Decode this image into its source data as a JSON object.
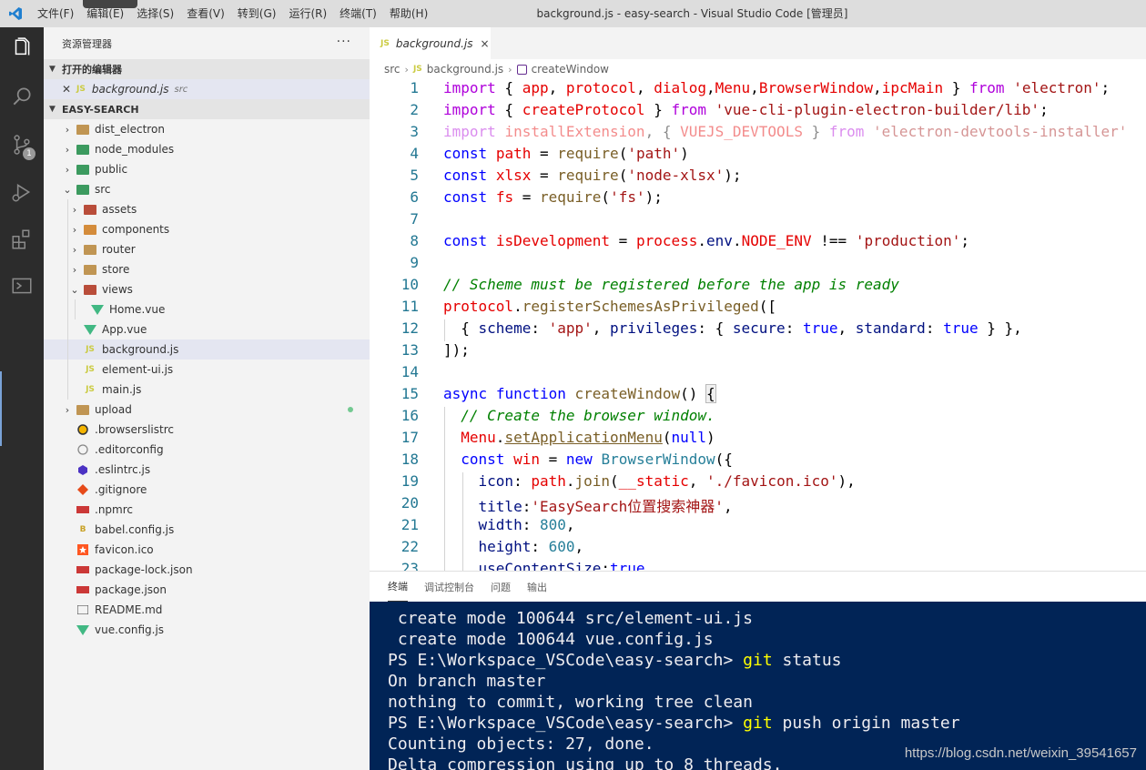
{
  "titlebar": {
    "menu": [
      "文件(F)",
      "编辑(E)",
      "选择(S)",
      "查看(V)",
      "转到(G)",
      "运行(R)",
      "终端(T)",
      "帮助(H)"
    ],
    "title": "background.js - easy-search - Visual Studio Code [管理员]"
  },
  "activity": {
    "scm_badge": "1"
  },
  "sidebar": {
    "header": "资源管理器",
    "more": "···",
    "open_editors_label": "打开的编辑器",
    "open_editor": {
      "name": "background.js",
      "desc": "src"
    },
    "workspace_label": "EASY-SEARCH",
    "tree": [
      {
        "name": "dist_electron",
        "type": "folder",
        "depth": 0,
        "twisty": "›",
        "icon": "folder"
      },
      {
        "name": "node_modules",
        "type": "folder",
        "depth": 0,
        "twisty": "›",
        "icon": "folder-green"
      },
      {
        "name": "public",
        "type": "folder",
        "depth": 0,
        "twisty": "›",
        "icon": "folder-green"
      },
      {
        "name": "src",
        "type": "folder",
        "depth": 0,
        "twisty": "⌄",
        "icon": "folder-green"
      },
      {
        "name": "assets",
        "type": "folder",
        "depth": 1,
        "twisty": "›",
        "icon": "folder-red"
      },
      {
        "name": "components",
        "type": "folder",
        "depth": 1,
        "twisty": "›",
        "icon": "folder-orange"
      },
      {
        "name": "router",
        "type": "folder",
        "depth": 1,
        "twisty": "›",
        "icon": "folder"
      },
      {
        "name": "store",
        "type": "folder",
        "depth": 1,
        "twisty": "›",
        "icon": "folder"
      },
      {
        "name": "views",
        "type": "folder",
        "depth": 1,
        "twisty": "⌄",
        "icon": "folder-red"
      },
      {
        "name": "Home.vue",
        "type": "file",
        "depth": 2,
        "icon": "vue"
      },
      {
        "name": "App.vue",
        "type": "file",
        "depth": 1,
        "icon": "vue"
      },
      {
        "name": "background.js",
        "type": "file",
        "depth": 1,
        "icon": "js",
        "selected": true
      },
      {
        "name": "element-ui.js",
        "type": "file",
        "depth": 1,
        "icon": "js"
      },
      {
        "name": "main.js",
        "type": "file",
        "depth": 1,
        "icon": "js"
      },
      {
        "name": "upload",
        "type": "folder",
        "depth": 0,
        "twisty": "›",
        "icon": "folder",
        "modified": true
      },
      {
        "name": ".browserslistrc",
        "type": "file",
        "depth": 0,
        "icon": "browserslist"
      },
      {
        "name": ".editorconfig",
        "type": "file",
        "depth": 0,
        "icon": "editorconfig"
      },
      {
        "name": ".eslintrc.js",
        "type": "file",
        "depth": 0,
        "icon": "eslint"
      },
      {
        "name": ".gitignore",
        "type": "file",
        "depth": 0,
        "icon": "git"
      },
      {
        "name": ".npmrc",
        "type": "file",
        "depth": 0,
        "icon": "npm"
      },
      {
        "name": "babel.config.js",
        "type": "file",
        "depth": 0,
        "icon": "babel"
      },
      {
        "name": "favicon.ico",
        "type": "file",
        "depth": 0,
        "icon": "favicon"
      },
      {
        "name": "package-lock.json",
        "type": "file",
        "depth": 0,
        "icon": "npm"
      },
      {
        "name": "package.json",
        "type": "file",
        "depth": 0,
        "icon": "npm"
      },
      {
        "name": "README.md",
        "type": "file",
        "depth": 0,
        "icon": "readme"
      },
      {
        "name": "vue.config.js",
        "type": "file",
        "depth": 0,
        "icon": "vue"
      }
    ]
  },
  "tab": {
    "badge": "JS",
    "name": "background.js",
    "close": "×"
  },
  "breadcrumb": {
    "folder": "src",
    "file": "background.js",
    "symbol": "createWindow"
  },
  "editor": {
    "line_numbers": [
      "1",
      "2",
      "3",
      "4",
      "5",
      "6",
      "7",
      "8",
      "9",
      "10",
      "11",
      "12",
      "13",
      "14",
      "15",
      "16",
      "17",
      "18",
      "19",
      "20",
      "21",
      "22",
      "23"
    ]
  },
  "panel": {
    "tabs": [
      "终端",
      "调试控制台",
      "问题",
      "输出"
    ],
    "terminal_lines": [
      {
        "pre": " create mode 100644 src/element-ui.js"
      },
      {
        "pre": " create mode 100644 vue.config.js"
      },
      {
        "pre": "PS E:\\Workspace_VSCode\\easy-search> ",
        "cmd": "git",
        "post": " status"
      },
      {
        "pre": "On branch master"
      },
      {
        "pre": "nothing to commit, working tree clean"
      },
      {
        "pre": "PS E:\\Workspace_VSCode\\easy-search> ",
        "cmd": "git",
        "post": " push origin master"
      },
      {
        "pre": "Counting objects: 27, done."
      },
      {
        "pre": "Delta compression using up to 8 threads."
      }
    ]
  },
  "watermark": "https://blog.csdn.net/weixin_39541657"
}
